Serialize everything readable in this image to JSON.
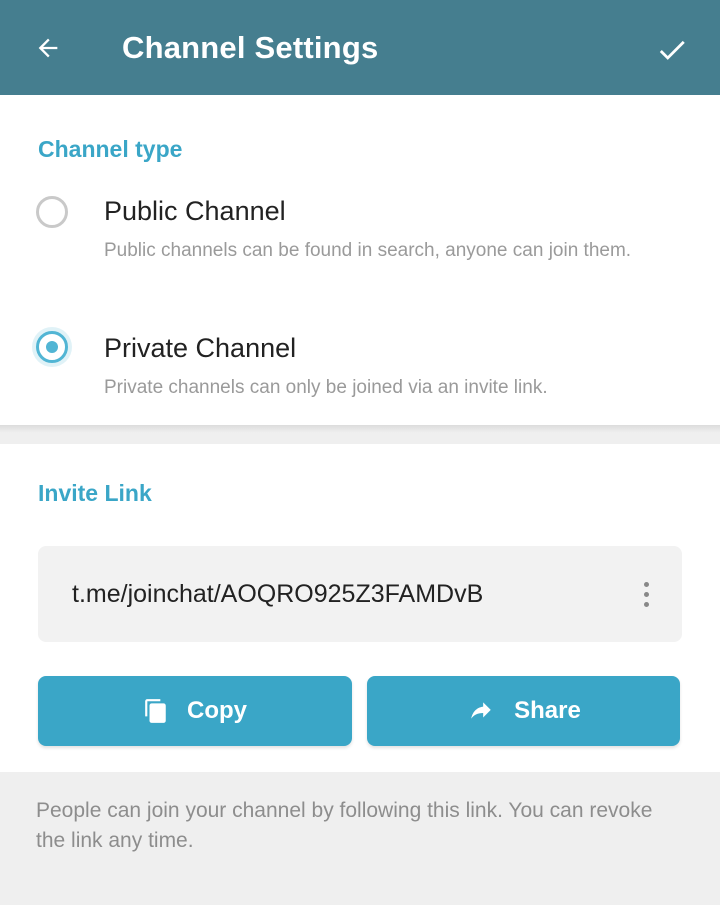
{
  "appbar": {
    "title": "Channel Settings",
    "back_icon": "arrow-left-icon",
    "confirm_icon": "checkmark-icon",
    "color": "#457e8f"
  },
  "channel_type": {
    "header": "Channel type",
    "options": [
      {
        "title": "Public Channel",
        "description": "Public channels can be found in search, anyone can join them.",
        "selected": false
      },
      {
        "title": "Private Channel",
        "description": "Private channels can only be joined via an invite link.",
        "selected": true
      }
    ]
  },
  "invite": {
    "header": "Invite Link",
    "link": "t.me/joinchat/AOQRO925Z3FAMDvB",
    "copy_label": "Copy",
    "share_label": "Share",
    "footer": "People can join your channel by following this link. You can revoke the link any time."
  },
  "colors": {
    "accent": "#3aa6c7",
    "radio": "#51b5d4"
  }
}
